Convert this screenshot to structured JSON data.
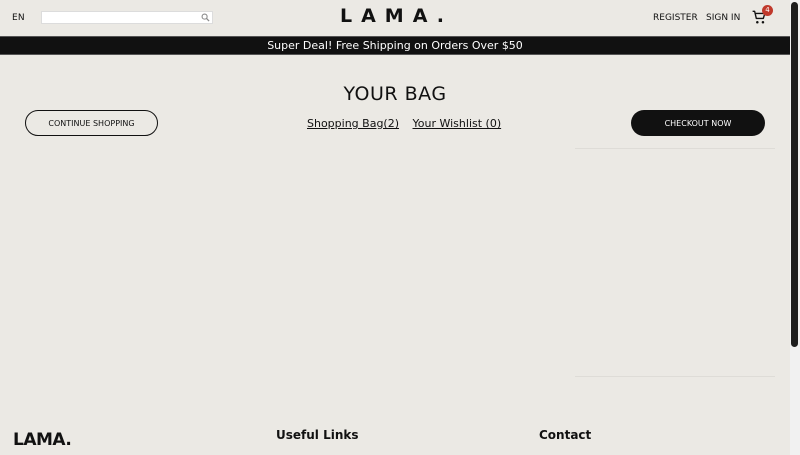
{
  "navbar": {
    "language": "EN",
    "search_placeholder": "",
    "logo": "LAMA.",
    "register": "REGISTER",
    "sign_in": "SIGN IN",
    "cart_count": "4",
    "cart_icon": "cart-icon",
    "search_icon": "search-icon"
  },
  "announcement": {
    "text": "Super Deal! Free Shipping on Orders Over $50"
  },
  "bag": {
    "title": "YOUR BAG",
    "continue_label": "CONTINUE SHOPPING",
    "shopping_bag_link": "Shopping Bag(2)",
    "wishlist_link": "Your Wishlist (0)",
    "checkout_label": "CHECKOUT NOW"
  },
  "footer": {
    "logo": "LAMA.",
    "useful_links_title": "Useful Links",
    "contact_title": "Contact"
  },
  "colors": {
    "background": "#ebe9e4",
    "announcement_bg": "#111111",
    "primary_button": "#111111",
    "badge": "#c0392b"
  }
}
